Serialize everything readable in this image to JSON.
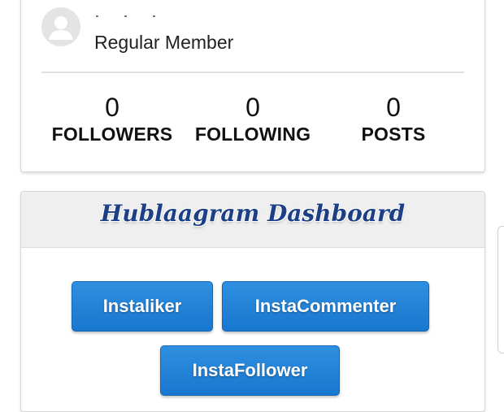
{
  "profile": {
    "role": "Regular Member",
    "stats": [
      {
        "value": "0",
        "label": "FOLLOWERS"
      },
      {
        "value": "0",
        "label": "FOLLOWING"
      },
      {
        "value": "0",
        "label": "POSTS"
      }
    ]
  },
  "dashboard": {
    "title": "Hublaagram Dashboard",
    "buttons": {
      "instaliker": "Instaliker",
      "instacommenter": "InstaCommenter",
      "instafollower": "InstaFollower"
    }
  },
  "colors": {
    "button": "#1f80d6",
    "title": "#1c3f86",
    "header_bg": "#efefef"
  },
  "icons": {
    "avatar": "user-silhouette-icon"
  }
}
